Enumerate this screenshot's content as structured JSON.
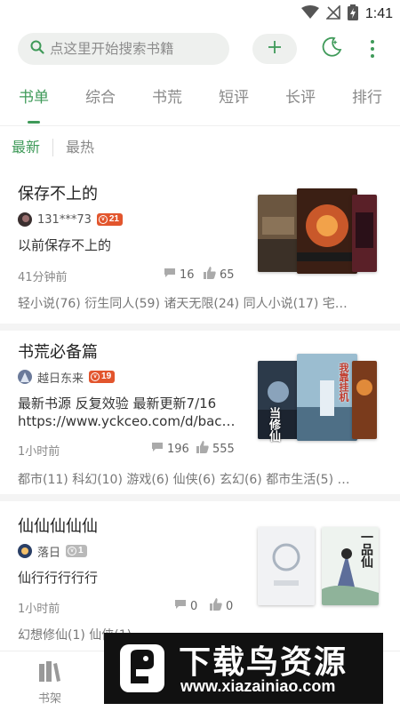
{
  "status_bar": {
    "time": "1:41"
  },
  "search": {
    "placeholder": "点这里开始搜索书籍"
  },
  "tabs": [
    {
      "label": "书单",
      "active": true
    },
    {
      "label": "综合",
      "active": false
    },
    {
      "label": "书荒",
      "active": false
    },
    {
      "label": "短评",
      "active": false
    },
    {
      "label": "长评",
      "active": false
    },
    {
      "label": "排行",
      "active": false
    }
  ],
  "sort": [
    {
      "label": "最新",
      "active": true
    },
    {
      "label": "最热",
      "active": false
    }
  ],
  "books": [
    {
      "title": "保存不上的",
      "user": "131***73",
      "level": "21",
      "desc": "以前保存不上的",
      "time": "41分钟前",
      "comments": "16",
      "likes": "65",
      "tags": "轻小说(76) 衍生同人(59) 诸天无限(24) 同人小说(17) 宅…"
    },
    {
      "title": "书荒必备篇",
      "user": "越日东来",
      "level": "19",
      "desc_line1": "最新书源 反复效验 最新更新7/16",
      "desc_line2": "https://www.yckceo.com/d/bac…",
      "time": "1小时前",
      "comments": "196",
      "likes": "555",
      "tags": "都市(11) 科幻(10) 游戏(6) 仙侠(6) 玄幻(6) 都市生活(5) …",
      "cover_texts": [
        "我靠挂机",
        "当修仙"
      ]
    },
    {
      "title": "仙仙仙仙仙",
      "user": "落日",
      "level": "1",
      "desc": "仙行行行行行",
      "time": "1小时前",
      "comments": "0",
      "likes": "0",
      "tags": "幻想修仙(1) 仙侠(1)",
      "cover_texts": [
        "一品仙"
      ]
    }
  ],
  "bottom_nav": {
    "shelf_label": "书架"
  },
  "watermark": {
    "title": "下载鸟资源",
    "url": "www.xiazainiao.com"
  },
  "colors": {
    "accent": "#3f9a59",
    "badge": "#e2552d",
    "badge_grey": "#b9b9b9"
  }
}
